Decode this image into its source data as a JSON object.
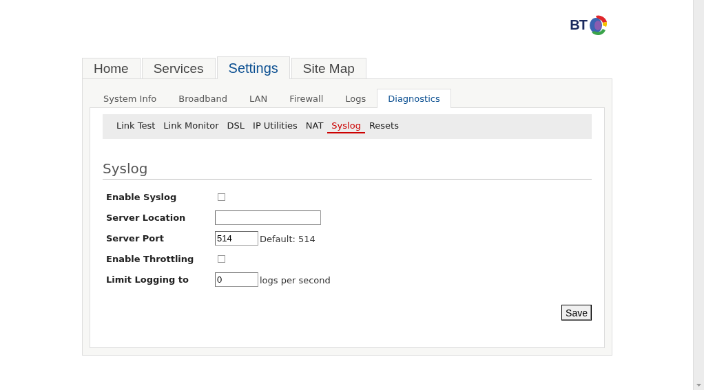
{
  "logo": {
    "text": "BT"
  },
  "main_tabs": [
    {
      "label": "Home",
      "selected": false
    },
    {
      "label": "Services",
      "selected": false
    },
    {
      "label": "Settings",
      "selected": true
    },
    {
      "label": "Site Map",
      "selected": false
    }
  ],
  "sub_tabs": [
    {
      "label": "System Info",
      "selected": false
    },
    {
      "label": "Broadband",
      "selected": false
    },
    {
      "label": "LAN",
      "selected": false
    },
    {
      "label": "Firewall",
      "selected": false
    },
    {
      "label": "Logs",
      "selected": false
    },
    {
      "label": "Diagnostics",
      "selected": true
    }
  ],
  "section_nav": [
    {
      "label": "Link Test",
      "selected": false
    },
    {
      "label": "Link Monitor",
      "selected": false
    },
    {
      "label": "DSL",
      "selected": false
    },
    {
      "label": "IP Utilities",
      "selected": false
    },
    {
      "label": "NAT",
      "selected": false
    },
    {
      "label": "Syslog",
      "selected": true
    },
    {
      "label": "Resets",
      "selected": false
    }
  ],
  "heading": "Syslog",
  "form": [
    {
      "label": "Enable Syslog",
      "kind": "checkbox",
      "checked": false
    },
    {
      "label": "Server Location",
      "kind": "wide-input"
    },
    {
      "label": "Server Port",
      "kind": "input",
      "value": "514",
      "suffix": "Default: 514"
    },
    {
      "label": "Enable Throttling",
      "kind": "checkbox",
      "checked": false
    },
    {
      "label": "Limit Logging to",
      "kind": "input",
      "value": "0",
      "suffix": "logs per second"
    }
  ],
  "save_button": "Save"
}
